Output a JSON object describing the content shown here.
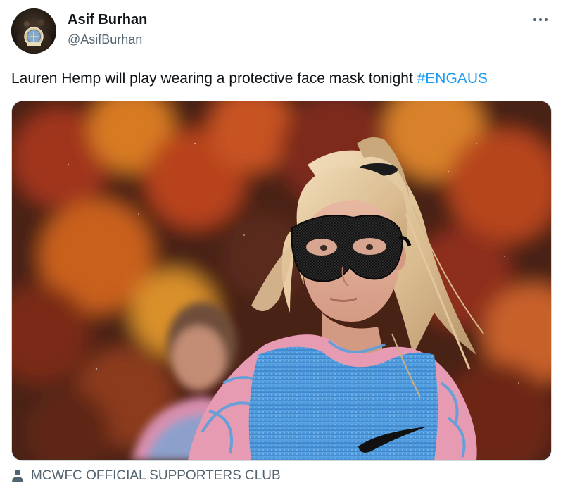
{
  "author": {
    "display_name": "Asif Burhan",
    "handle": "@AsifBurhan",
    "avatar_icon": "club-crest-avatar"
  },
  "more_menu": {
    "icon": "more-horizontal-icon",
    "label": "···"
  },
  "tweet": {
    "text": "Lauren Hemp will play wearing a protective face mask tonight ",
    "hashtag": "#ENGAUS"
  },
  "media": {
    "alt": "Player wearing black protective face mask in blue training bib",
    "brand_mark": "swoosh"
  },
  "footer": {
    "icon": "person-icon",
    "label": "MCWFC OFFICIAL SUPPORTERS CLUB"
  },
  "colors": {
    "link": "#1d9bf0",
    "secondary_text": "#536471",
    "primary_text": "#0f1419"
  }
}
